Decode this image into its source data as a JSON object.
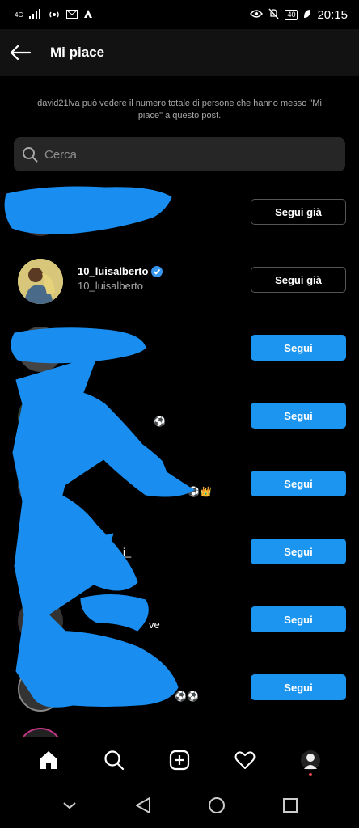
{
  "status_bar": {
    "network": "4G",
    "battery": "40",
    "time": "20:15"
  },
  "header": {
    "title": "Mi piace"
  },
  "info": {
    "text": "david21lva può vedere il numero totale di persone che hanno messo \"Mi piace\" a questo post."
  },
  "search": {
    "placeholder": "Cerca"
  },
  "users": [
    {
      "username": "",
      "fullname": "",
      "button": "Segui già"
    },
    {
      "username": "10_luisalberto",
      "fullname": "10_luisalberto",
      "verified": true,
      "button": "Segui già"
    },
    {
      "username": "",
      "fullname": "",
      "button": "Segui"
    },
    {
      "username": "",
      "fullname": "",
      "emoji": "⚽",
      "button": "Segui"
    },
    {
      "username": "",
      "fullname": "",
      "emoji": "⚽👑",
      "button": "Segui"
    },
    {
      "username": "",
      "fullname": "i_",
      "button": "Segui"
    },
    {
      "username": "",
      "fullname": "ve",
      "button": "Segui"
    },
    {
      "username": "",
      "fullname": "",
      "emoji": "⚽⚽",
      "button": "Segui"
    }
  ],
  "nav": {
    "items": [
      "home-icon",
      "search-icon",
      "add-post-icon",
      "heart-icon",
      "profile-avatar"
    ]
  },
  "colors": {
    "follow_blue": "#1b95f0",
    "scribble_blue": "#1a8ef0",
    "verified_blue": "#3897f0"
  }
}
